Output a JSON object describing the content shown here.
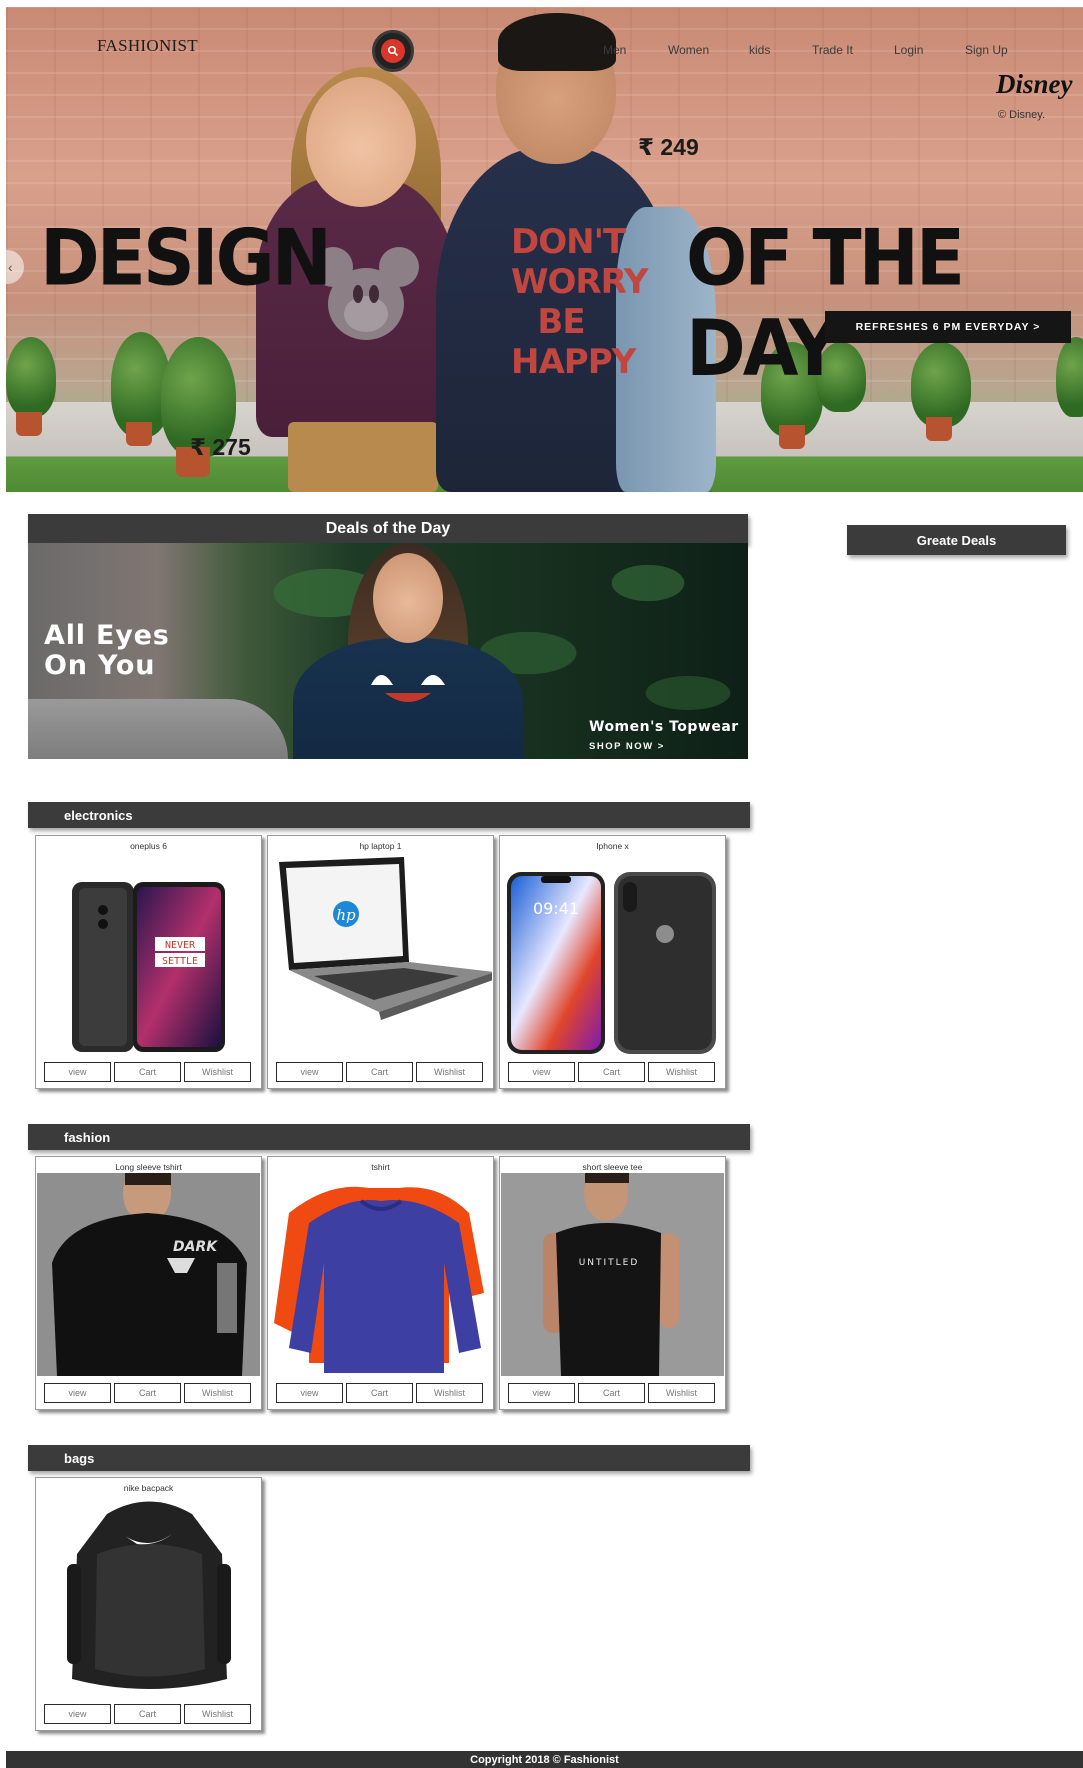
{
  "header": {
    "brand": "FASHIONIST",
    "nav": [
      "Men",
      "Women",
      "kids",
      "Trade It",
      "Login",
      "Sign Up"
    ]
  },
  "hero": {
    "logo_text": "Disney",
    "copyright": "© Disney.",
    "price_man": "₹ 249",
    "price_woman": "₹ 275",
    "title_left": "DESIGN",
    "title_right": "OF THE DAY",
    "cta": "REFRESHES 6 PM EVERYDAY >",
    "tee_text": "DON'T WORRY BE HAPPY"
  },
  "deals": {
    "heading": "Deals of the Day",
    "banner_line1": "All Eyes",
    "banner_line2": "On You",
    "banner_sub": "Women's Topwear",
    "banner_cta": "SHOP NOW >",
    "side_button": "Greate Deals"
  },
  "actions": {
    "view": "view",
    "cart": "Cart",
    "wishlist": "Wishlist"
  },
  "sections": {
    "electronics": {
      "label": "electronics",
      "items": [
        {
          "title": "oneplus 6",
          "screen_text_1": "NEVER",
          "screen_text_2": "SETTLE"
        },
        {
          "title": "hp laptop 1",
          "logo": "hp"
        },
        {
          "title": "Iphone x",
          "clock": "09:41"
        }
      ]
    },
    "fashion": {
      "label": "fashion",
      "items": [
        {
          "title": "Long sleeve tshirt",
          "print": "DARK"
        },
        {
          "title": "tshirt"
        },
        {
          "title": "short sleeve tee",
          "print": "UNTITLED"
        }
      ]
    },
    "bags": {
      "label": "bags",
      "items": [
        {
          "title": "nike bacpack"
        }
      ]
    }
  },
  "footer": {
    "text": "Copyright 2018 © Fashionist"
  },
  "colors": {
    "bar": "#3b3b3b",
    "search_accent": "#d9372a",
    "footer": "#333333"
  }
}
